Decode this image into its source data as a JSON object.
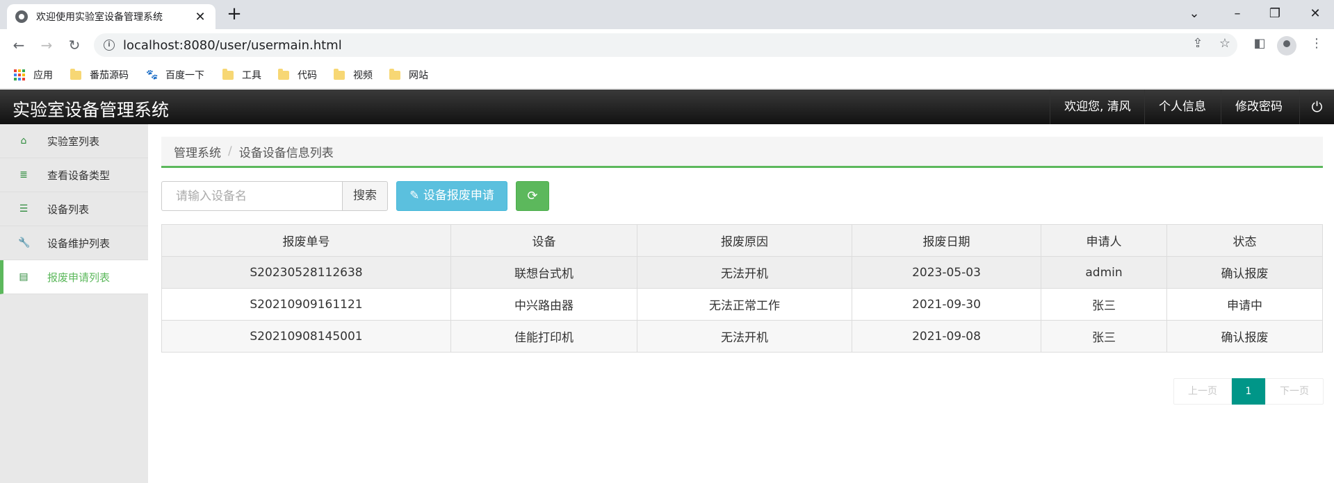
{
  "browser": {
    "tab_title": "欢迎使用实验室设备管理系统",
    "url": "localhost:8080/user/usermain.html",
    "bookmarks": [
      "应用",
      "番茄源码",
      "百度一下",
      "工具",
      "代码",
      "视频",
      "网站"
    ]
  },
  "header": {
    "brand": "实验室设备管理系统",
    "welcome": "欢迎您, 清风",
    "profile": "个人信息",
    "change_password": "修改密码"
  },
  "sidebar": {
    "items": [
      {
        "label": "实验室列表",
        "icon": "home-icon"
      },
      {
        "label": "查看设备类型",
        "icon": "database-icon"
      },
      {
        "label": "设备列表",
        "icon": "list-icon"
      },
      {
        "label": "设备维护列表",
        "icon": "wrench-icon"
      },
      {
        "label": "报废申请列表",
        "icon": "archive-icon",
        "active": true
      }
    ]
  },
  "breadcrumb": {
    "root": "管理系统",
    "separator": "/",
    "current": "设备设备信息列表"
  },
  "toolbar": {
    "search_placeholder": "请输入设备名",
    "search_label": "搜索",
    "apply_label": "设备报废申请"
  },
  "table": {
    "columns": [
      "报废单号",
      "设备",
      "报废原因",
      "报废日期",
      "申请人",
      "状态"
    ],
    "rows": [
      [
        "S20230528112638",
        "联想台式机",
        "无法开机",
        "2023-05-03",
        "admin",
        "确认报废"
      ],
      [
        "S20210909161121",
        "中兴路由器",
        "无法正常工作",
        "2021-09-30",
        "张三",
        "申请中"
      ],
      [
        "S20210908145001",
        "佳能打印机",
        "无法开机",
        "2021-09-08",
        "张三",
        "确认报废"
      ]
    ]
  },
  "pagination": {
    "prev": "上一页",
    "current": "1",
    "next": "下一页"
  },
  "colors": {
    "accent_green": "#5cb85c",
    "info_blue": "#5bc0de",
    "page_teal": "#009688"
  }
}
